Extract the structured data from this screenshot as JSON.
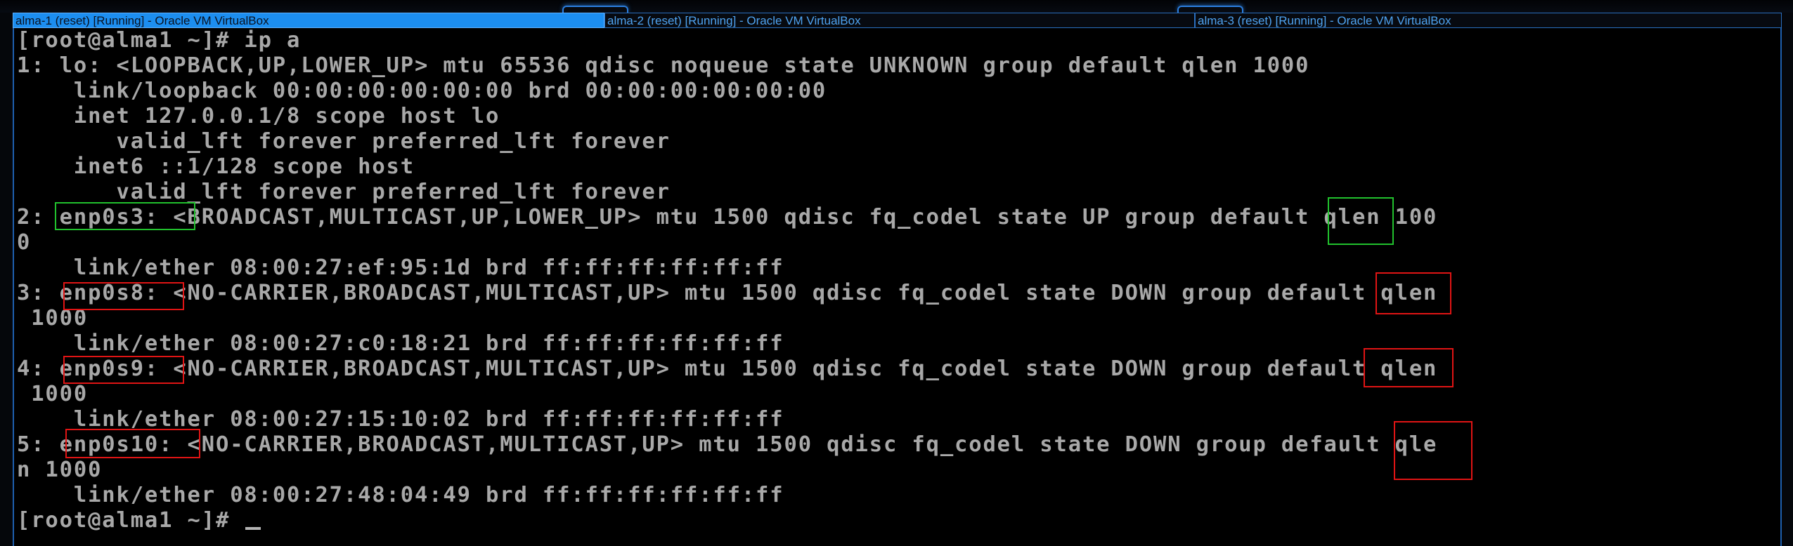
{
  "windows": [
    {
      "title": "alma-1 (reset) [Running] - Oracle VM VirtualBox",
      "active": true
    },
    {
      "title": "alma-2 (reset) [Running] - Oracle VM VirtualBox",
      "active": false
    },
    {
      "title": "alma-3 (reset) [Running] - Oracle VM VirtualBox",
      "active": false
    }
  ],
  "terminal": {
    "lines": [
      "[root@alma1 ~]# ip a",
      "1: lo: <LOOPBACK,UP,LOWER_UP> mtu 65536 qdisc noqueue state UNKNOWN group default qlen 1000",
      "    link/loopback 00:00:00:00:00:00 brd 00:00:00:00:00:00",
      "    inet 127.0.0.1/8 scope host lo",
      "       valid_lft forever preferred_lft forever",
      "    inet6 ::1/128 scope host",
      "       valid_lft forever preferred_lft forever",
      "2: enp0s3: <BROADCAST,MULTICAST,UP,LOWER_UP> mtu 1500 qdisc fq_codel state UP group default qlen 100",
      "0",
      "    link/ether 08:00:27:ef:95:1d brd ff:ff:ff:ff:ff:ff",
      "3: enp0s8: <NO-CARRIER,BROADCAST,MULTICAST,UP> mtu 1500 qdisc fq_codel state DOWN group default qlen",
      " 1000",
      "    link/ether 08:00:27:c0:18:21 brd ff:ff:ff:ff:ff:ff",
      "4: enp0s9: <NO-CARRIER,BROADCAST,MULTICAST,UP> mtu 1500 qdisc fq_codel state DOWN group default qlen",
      " 1000",
      "    link/ether 08:00:27:15:10:02 brd ff:ff:ff:ff:ff:ff",
      "5: enp0s10: <NO-CARRIER,BROADCAST,MULTICAST,UP> mtu 1500 qdisc fq_codel state DOWN group default qle",
      "n 1000",
      "    link/ether 08:00:27:48:04:49 brd ff:ff:ff:ff:ff:ff",
      "[root@alma1 ~]# "
    ]
  },
  "highlights": [
    {
      "target": "enp0s3",
      "color": "#21c12d"
    },
    {
      "target": "UP",
      "color": "#21c12d"
    },
    {
      "target": "enp0s8",
      "color": "#e01414"
    },
    {
      "target": "DOWN",
      "color": "#e01414"
    },
    {
      "target": "enp0s9",
      "color": "#e01414"
    },
    {
      "target": "DOWN",
      "color": "#e01414"
    },
    {
      "target": "enp0s10",
      "color": "#e01414"
    },
    {
      "target": "DOWN",
      "color": "#e01414"
    }
  ],
  "colors": {
    "active_title_bg": "#1c8ef0",
    "inactive_title_text": "#4fa3f0",
    "terminal_bg": "#000000",
    "terminal_text": "#a8a8a8"
  }
}
